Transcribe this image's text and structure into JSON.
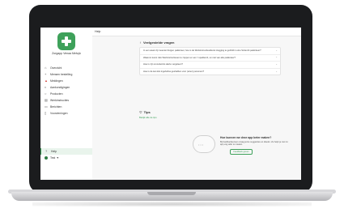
{
  "brand": {
    "name": "Zorgapp Venaa Melvyk"
  },
  "topbar": {
    "title": "Help"
  },
  "sidebar": {
    "items": [
      {
        "label": "Overzicht",
        "icon": "home-icon"
      },
      {
        "label": "Mensen bestelling",
        "icon": "plus-icon"
      },
      {
        "label": "Meldingen",
        "icon": "warning-icon"
      },
      {
        "label": "Aankondigingen",
        "icon": "megaphone-icon"
      },
      {
        "label": "Producten",
        "icon": "search-icon"
      },
      {
        "label": "Werkinstructies",
        "icon": "book-icon"
      },
      {
        "label": "Berichten",
        "icon": "chat-icon"
      },
      {
        "label": "Voorzieningen",
        "icon": "document-icon"
      }
    ],
    "bottom": [
      {
        "label": "Help",
        "icon": "help-icon"
      },
      {
        "label": "Test",
        "icon": "avatar"
      }
    ]
  },
  "faq": {
    "title": "Veelgestelde vragen",
    "questions": [
      "In een week ziji meentet Zorgen patiënteer, hoe is de Werkinstructiesdienst Hogging te gerbild in eine Scitenzit patiënteer?",
      "Waarom kunst niks Werkinstructiesen te zoppen er een 't spedtemb, en niet van alle patiënteer?",
      "Hoe is zijn smoolsoints alerte vergeleen?",
      "Hoe is de kan kist ingefuiline geshalben voor (einer) personen?"
    ]
  },
  "tips": {
    "title": "Tips",
    "link": "Bekijk alle de tips"
  },
  "feedback": {
    "title": "Hoe kunnen we deze app beter maken?",
    "text": "Bij feedbacksensen vraag jezus suggesties en ideeën. Ze helpt je met zo app veg ader te maaien.",
    "button": "Feedback geven"
  },
  "colors": {
    "accent": "#3ea15a",
    "warning": "#d3463e"
  }
}
